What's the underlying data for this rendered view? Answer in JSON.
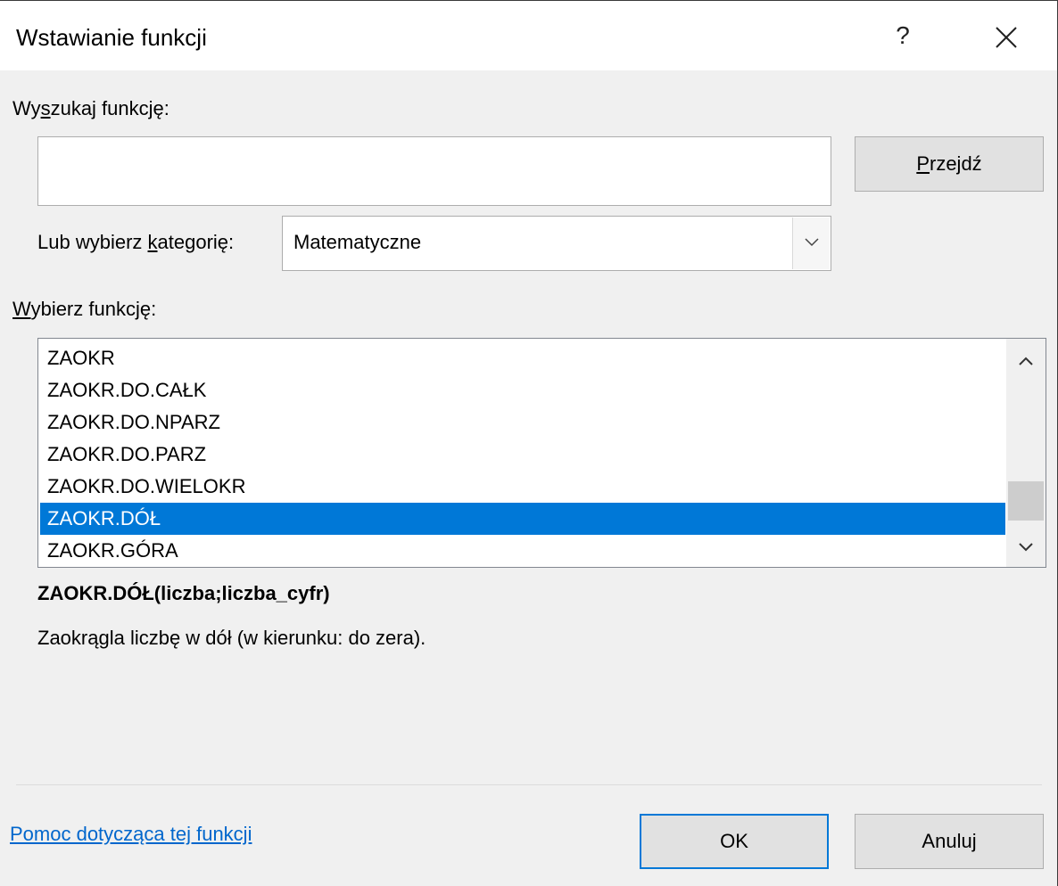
{
  "dialog": {
    "title": "Wstawianie funkcji",
    "help_glyph": "?",
    "close_icon": "close-icon"
  },
  "search": {
    "label_before": "Wy",
    "label_accel": "s",
    "label_after": "zukaj funkcję:",
    "value": "",
    "go_button_accel": "P",
    "go_button_rest": "rzejdź"
  },
  "category": {
    "label_before": "Lub wybierz ",
    "label_accel": "k",
    "label_after": "ategorię:",
    "selected": "Matematyczne",
    "arrow_icon": "chevron-down-icon"
  },
  "functions": {
    "label_accel": "W",
    "label_rest": "ybierz funkcję:",
    "items": [
      "ZAOKR",
      "ZAOKR.DO.CAŁK",
      "ZAOKR.DO.NPARZ",
      "ZAOKR.DO.PARZ",
      "ZAOKR.DO.WIELOKR",
      "ZAOKR.DÓŁ",
      "ZAOKR.GÓRA"
    ],
    "selected_index": 5,
    "selection_color": "#0078d7"
  },
  "details": {
    "signature": "ZAOKR.DÓŁ(liczba;liczba_cyfr)",
    "description": "Zaokrągla liczbę w dół (w kierunku: do zera)."
  },
  "footer": {
    "help_link": "Pomoc dotycząca tej funkcji",
    "ok_label": "OK",
    "cancel_label": "Anuluj"
  }
}
